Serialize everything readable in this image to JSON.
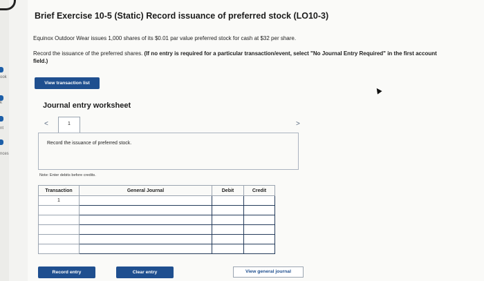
{
  "left_rail": {
    "items": [
      "ook",
      "k",
      "nt",
      "nces"
    ]
  },
  "header": {
    "title": "Brief Exercise 10-5 (Static) Record issuance of preferred stock (LO10-3)"
  },
  "problem": {
    "line1": "Equinox Outdoor Wear issues 1,000 shares of its $0.01 par value preferred stock for cash at $32 per share.",
    "line2_plain": "Record the issuance of the preferred shares. ",
    "line2_bold": "(If no entry is required for a particular transaction/event, select \"No Journal Entry Required\" in the first account field.)"
  },
  "buttons": {
    "view_transaction_list": "View transaction list",
    "record_entry": "Record entry",
    "clear_entry": "Clear entry",
    "view_general_journal": "View general journal"
  },
  "worksheet": {
    "title": "Journal entry worksheet",
    "prev_arrow": "<",
    "next_arrow": ">",
    "tab_label": "1",
    "instruction": "Record the issuance of preferred stock.",
    "note": "Note: Enter debits before credits."
  },
  "journal": {
    "headers": [
      "Transaction",
      "General Journal",
      "Debit",
      "Credit"
    ],
    "rows": [
      {
        "transaction": "1",
        "account": "",
        "debit": "",
        "credit": ""
      },
      {
        "transaction": "",
        "account": "",
        "debit": "",
        "credit": ""
      },
      {
        "transaction": "",
        "account": "",
        "debit": "",
        "credit": ""
      },
      {
        "transaction": "",
        "account": "",
        "debit": "",
        "credit": ""
      },
      {
        "transaction": "",
        "account": "",
        "debit": "",
        "credit": ""
      },
      {
        "transaction": "",
        "account": "",
        "debit": "",
        "credit": ""
      }
    ]
  },
  "colors": {
    "accent": "#1f4f8f",
    "border": "#9aa4b0"
  }
}
